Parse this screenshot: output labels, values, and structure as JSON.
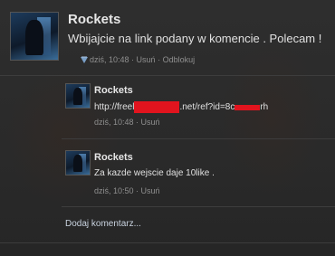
{
  "post": {
    "author": "Rockets",
    "message": "Wbijajcie na link podany w komencie . Polecam !",
    "time": "dziś, 10:48",
    "delete_label": "Usuń",
    "unblock_label": "Odblokuj"
  },
  "comments": [
    {
      "author": "Rockets",
      "link_part1": "http://freel",
      "link_part2": ".net/ref?id=8c",
      "link_part3": "rh",
      "time": "dziś, 10:48",
      "delete_label": "Usuń"
    },
    {
      "author": "Rockets",
      "text": "Za kazde wejscie daje 10like .",
      "time": "dziś, 10:50",
      "delete_label": "Usuń"
    }
  ],
  "add_comment_label": "Dodaj komentarz...",
  "colors": {
    "redaction": "#e1141e",
    "background": "#2c2c2c"
  },
  "icons": {
    "like": "heart-like-icon"
  }
}
